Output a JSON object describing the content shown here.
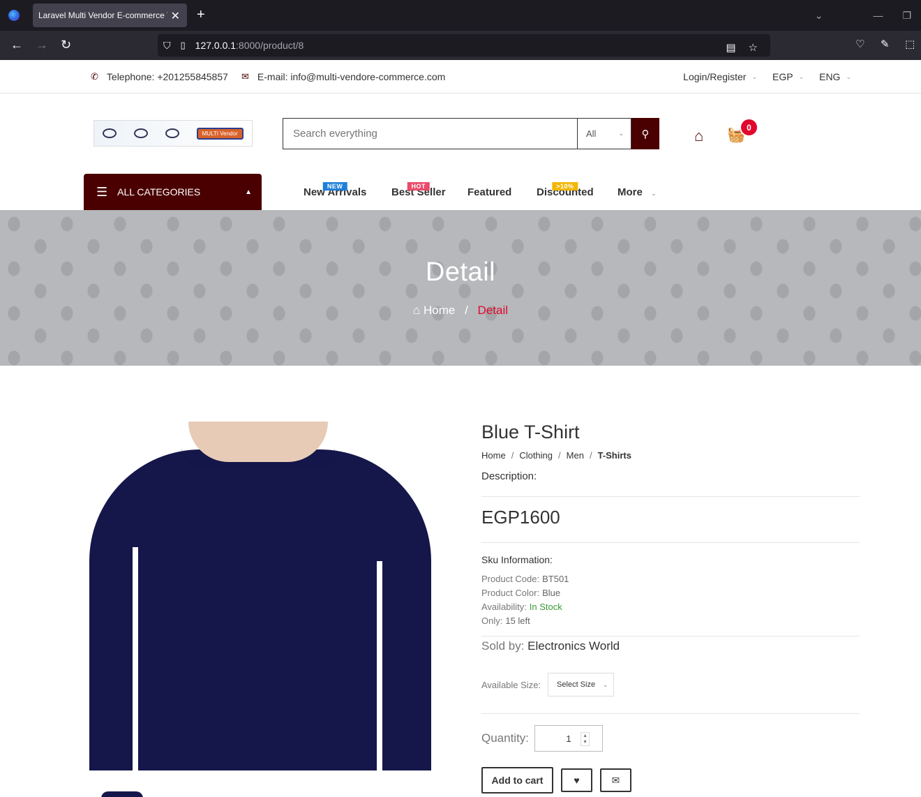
{
  "browser": {
    "tab_title": "Laravel Multi Vendor E-commerce T",
    "url_host": "127.0.0.1",
    "url_path": ":8000/product/8"
  },
  "topbar": {
    "telephone": "Telephone: +201255845857",
    "email": "E-mail: info@multi-vendore-commerce.com",
    "login": "Login/Register",
    "currency": "EGP",
    "language": "ENG"
  },
  "header": {
    "logo_text": "MULTI Vendor",
    "search_placeholder": "Search everything",
    "search_category": "All",
    "cart_count": "0"
  },
  "menu": {
    "all_categories": "ALL CATEGORIES",
    "items": [
      {
        "label": "New Arrivals",
        "tag": "NEW"
      },
      {
        "label": "Best Seller",
        "tag": "HOT"
      },
      {
        "label": "Featured",
        "tag": ""
      },
      {
        "label": "Discounted",
        "tag": ">10%"
      },
      {
        "label": "More",
        "tag": ""
      }
    ]
  },
  "banner": {
    "title": "Detail",
    "home": "Home",
    "sep": "/",
    "current": "Detail"
  },
  "product": {
    "name": "Blue T-Shirt",
    "breadcrumb": [
      "Home",
      "Clothing",
      "Men",
      "T-Shirts"
    ],
    "description_label": "Description:",
    "price": "EGP1600",
    "sku_heading": "Sku Information:",
    "code_label": "Product Code:",
    "code": "BT501",
    "color_label": "Product Color:",
    "color": "Blue",
    "availability_label": "Availability:",
    "availability": "In Stock",
    "only_label": "Only:",
    "only": "15 left",
    "sold_by_label": "Sold by:",
    "sold_by": "Electronics World",
    "size_label": "Available Size:",
    "size_placeholder": "Select Size",
    "quantity_label": "Quantity:",
    "quantity": "1",
    "add_to_cart": "Add to cart"
  },
  "colors": {
    "brand": "#4a0000",
    "accent": "#e0082c",
    "in_stock": "#3a9a3a"
  }
}
